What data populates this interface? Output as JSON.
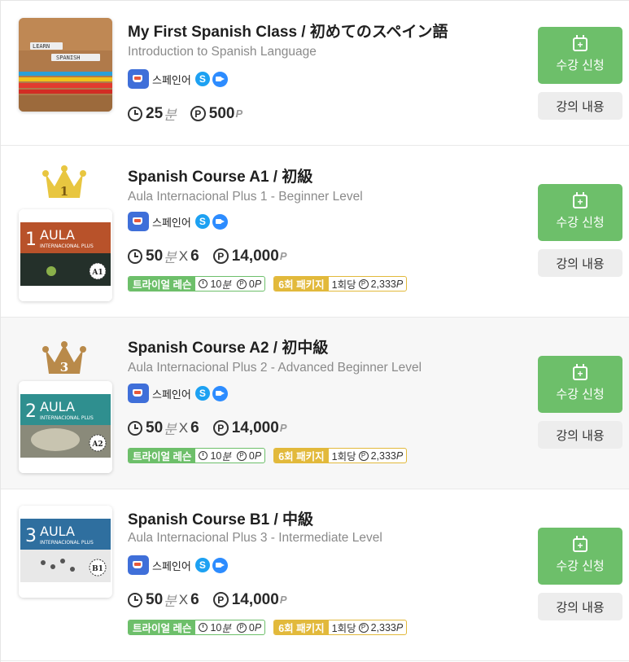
{
  "courses": [
    {
      "title": "My First Spanish Class / 初めてのスペイン語",
      "subtitle": "Introduction to Spanish Language",
      "language": "스페인어",
      "skype": "S",
      "duration": "25",
      "duration_unit": "분",
      "price": "500",
      "price_unit": "P",
      "enroll_label": "수강 신청",
      "detail_label": "강의 내용",
      "thumb_tiles_top": "LEARN",
      "thumb_tiles_bottom": "SPANISH"
    },
    {
      "rank": "1",
      "rank_color": "#e8c640",
      "title": "Spanish Course A1 / 初級",
      "subtitle": "Aula Internacional Plus 1 - Beginner Level",
      "language": "스페인어",
      "skype": "S",
      "duration": "50",
      "duration_unit": "분",
      "times_sign": "X",
      "sessions": "6",
      "price": "14,000",
      "price_unit": "P",
      "trial_label": "트라이얼 레슨",
      "trial_time": "10",
      "trial_time_unit": "분",
      "trial_price": "0",
      "trial_price_unit": "P",
      "pkg_label": "6회 패키지",
      "pkg_per": "1회당",
      "pkg_price": "2,333",
      "pkg_price_unit": "P",
      "enroll_label": "수강 신청",
      "detail_label": "강의 내용",
      "book_num": "1",
      "book_title": "AULA",
      "book_sub": "INTERNACIONAL PLUS",
      "book_level": "A1",
      "book_color": "#b8522a"
    },
    {
      "rank": "3",
      "rank_color": "#b98a4a",
      "title": "Spanish Course A2 / 初中級",
      "subtitle": "Aula Internacional Plus 2 - Advanced Beginner Level",
      "language": "스페인어",
      "skype": "S",
      "duration": "50",
      "duration_unit": "분",
      "times_sign": "X",
      "sessions": "6",
      "price": "14,000",
      "price_unit": "P",
      "trial_label": "트라이얼 레슨",
      "trial_time": "10",
      "trial_time_unit": "분",
      "trial_price": "0",
      "trial_price_unit": "P",
      "pkg_label": "6회 패키지",
      "pkg_per": "1회당",
      "pkg_price": "2,333",
      "pkg_price_unit": "P",
      "enroll_label": "수강 신청",
      "detail_label": "강의 내용",
      "book_num": "2",
      "book_title": "AULA",
      "book_sub": "INTERNACIONAL PLUS",
      "book_level": "A2",
      "book_color": "#2f8f8f"
    },
    {
      "title": "Spanish Course B1 / 中級",
      "subtitle": "Aula Internacional Plus 3 - Intermediate Level",
      "language": "스페인어",
      "skype": "S",
      "duration": "50",
      "duration_unit": "분",
      "times_sign": "X",
      "sessions": "6",
      "price": "14,000",
      "price_unit": "P",
      "trial_label": "트라이얼 레슨",
      "trial_time": "10",
      "trial_time_unit": "분",
      "trial_price": "0",
      "trial_price_unit": "P",
      "pkg_label": "6회 패키지",
      "pkg_per": "1회당",
      "pkg_price": "2,333",
      "pkg_price_unit": "P",
      "enroll_label": "수강 신청",
      "detail_label": "강의 내용",
      "book_num": "3",
      "book_title": "AULA",
      "book_sub": "INTERNACIONAL PLUS",
      "book_level": "B1",
      "book_color": "#2f6f9f"
    }
  ],
  "colors": {
    "accent_green": "#6dbf6a",
    "package_gold": "#e2b93b"
  }
}
